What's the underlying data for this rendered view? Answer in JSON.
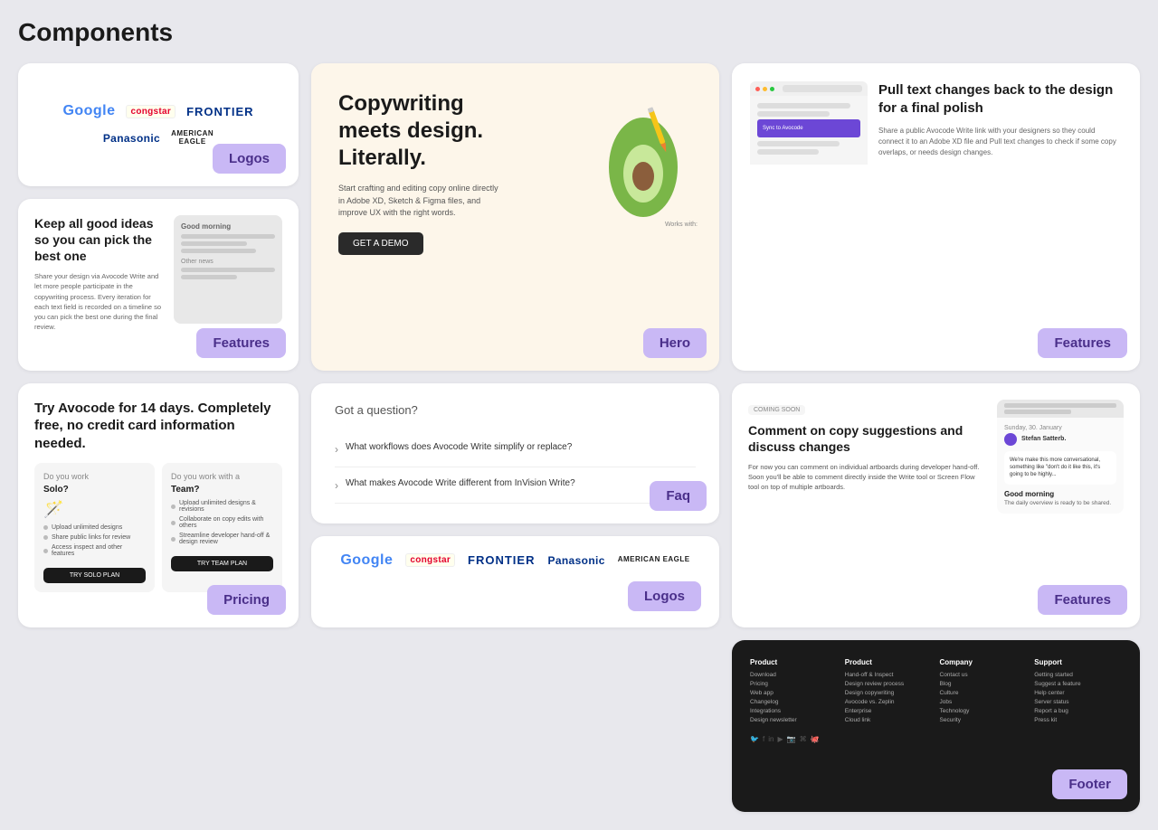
{
  "page": {
    "title": "Components"
  },
  "cards": {
    "logos1": {
      "badge": "Logos",
      "items": [
        "Google",
        "congstar",
        "FRONTIER",
        "Panasonic",
        "AMERICAN EAGLE"
      ]
    },
    "hero": {
      "badge": "Hero",
      "headline": "Copywriting meets design. Literally.",
      "description": "Start crafting and editing copy online directly in Adobe XD, Sketch & Figma files, and improve UX with the right words.",
      "cta": "GET A DEMO",
      "works_with": "Works with:"
    },
    "features1": {
      "badge": "Features",
      "headline": "Pull text changes back to the design for a final polish",
      "description": "Share a public Avocode Write link with your designers so they could connect it to an Adobe XD file and Pull text changes to check if some copy overlaps, or needs design changes."
    },
    "features2": {
      "badge": "Features",
      "headline": "Keep all good ideas so you can pick the best one",
      "description": "Share your design via Avocode Write and let more people participate in the copywriting process. Every iteration for each text field is recorded on a timeline so you can pick the best one during the final review."
    },
    "faq": {
      "badge": "Faq",
      "question_label": "Got a question?",
      "items": [
        "What workflows does Avocode Write simplify or replace?",
        "What makes Avocode Write different from InVision Write?"
      ]
    },
    "logos2": {
      "badge": "Logos",
      "items": [
        "Google",
        "congstar",
        "FRONTIER",
        "Panasonic",
        "AMERICAN EAGLE"
      ]
    },
    "pricing": {
      "badge": "Pricing",
      "headline": "Try Avocode for 14 days. Completely free, no credit card information needed.",
      "sub": "",
      "solo_title": "Do you work Solo?",
      "solo_icon": "🪄",
      "solo_features": [
        "Upload unlimited designs",
        "Share public links for review",
        "Access inspect and other features"
      ],
      "solo_btn": "TRY SOLO PLAN",
      "team_title": "Do you work with a Team?",
      "team_features": [
        "Upload unlimited designs & revisions",
        "Collaborate on copy edits with others",
        "Streamline developer hand-off & design review"
      ],
      "team_btn": "TRY TEAM PLAN"
    },
    "features3": {
      "badge": "Features",
      "coming_soon": "COMING SOON",
      "headline": "Comment on copy suggestions and discuss changes",
      "description": "For now you can comment on individual artboards during developer hand-off. Soon you'll be able to comment directly inside the Write tool or Screen Flow tool on top of multiple artboards.",
      "date": "Sunday, 30. January",
      "comment_preview": "We're make this more conversational, something like \"don't do it like this, it's going to be highly...",
      "comment_name": "Good morning",
      "comment_sub": "The daily overview is ready to be shared."
    },
    "footer": {
      "badge": "Footer",
      "logo": "⬡",
      "columns": {
        "product": {
          "title": "Product",
          "links": [
            "Hand-off & Inspect",
            "Design review process",
            "Design copywriting",
            "Avocode vs. Zeplin",
            "Enterprise",
            "Cloud link"
          ]
        },
        "company": {
          "title": "Company",
          "links": [
            "Contact us",
            "Blog",
            "Culture",
            "Jobs",
            "Technology",
            "Security"
          ]
        },
        "support": {
          "title": "Support",
          "links": [
            "Getting started",
            "Suggest a feature",
            "Help center",
            "Server status",
            "Report a bug",
            "Press kit"
          ]
        },
        "product_links": [
          "Download",
          "Pricing",
          "Web app",
          "Changelog",
          "Integrations",
          "Design newsletter"
        ]
      }
    }
  }
}
